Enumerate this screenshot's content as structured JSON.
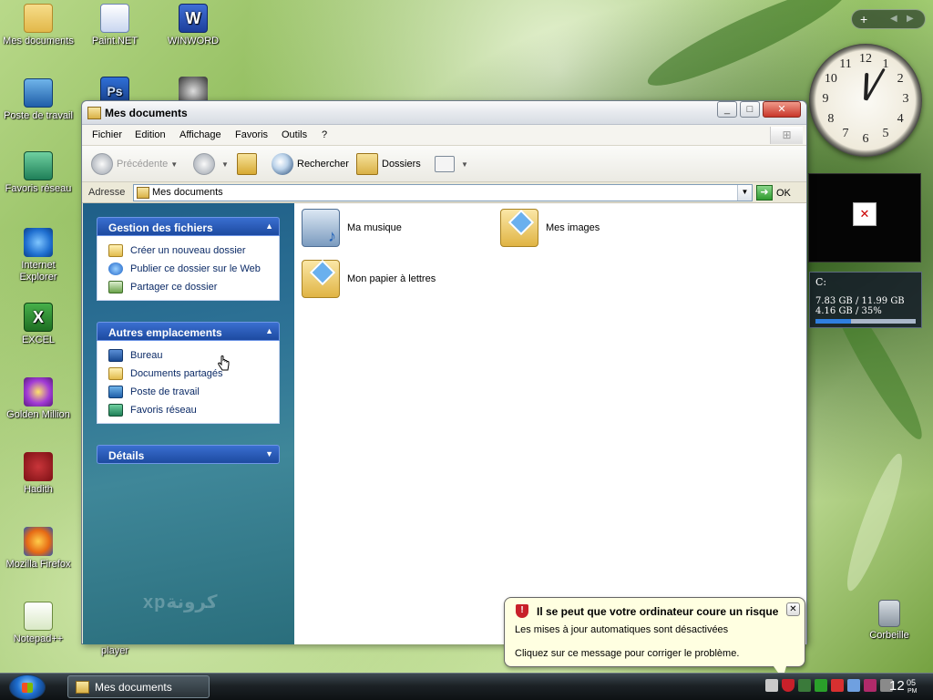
{
  "desktop": {
    "icons": [
      {
        "label": "Mes documents",
        "icon": "folder-icon"
      },
      {
        "label": "Paint.NET",
        "icon": "paint-icon"
      },
      {
        "label": "WINWORD",
        "icon": "word-icon"
      },
      {
        "label": "Poste de travail",
        "icon": "computer-icon"
      },
      {
        "label": "Favoris réseau",
        "icon": "network-icon"
      },
      {
        "label": "Internet Explorer",
        "icon": "ie-icon"
      },
      {
        "label": "EXCEL",
        "icon": "excel-icon"
      },
      {
        "label": "Golden Million",
        "icon": "golden-million-icon"
      },
      {
        "label": "Hadith",
        "icon": "hadith-icon"
      },
      {
        "label": "Mozilla Firefox",
        "icon": "firefox-icon"
      },
      {
        "label": "Notepad++",
        "icon": "notepad-icon"
      },
      {
        "label": "player",
        "icon": "player-icon"
      },
      {
        "label": "Corbeille",
        "icon": "recycle-bin-icon"
      }
    ],
    "ps_glyph": "Ps",
    "word_glyph": "W",
    "excel_glyph": "X"
  },
  "gadgets": {
    "clock": {
      "hour": 12,
      "minute": 5,
      "numbers": [
        "12",
        "1",
        "2",
        "3",
        "4",
        "5",
        "6",
        "7",
        "8",
        "9",
        "10",
        "11"
      ]
    },
    "toolbar_plus": "+",
    "toolbar_prev": "◀",
    "toolbar_next": "▶",
    "broken_image": "✕",
    "drive": {
      "title": "C:",
      "line1": "7.83 GB / 11.99 GB",
      "line2": "4.16 GB / 35%",
      "used_fraction": 0.35
    }
  },
  "window": {
    "title": "Mes documents",
    "controls": {
      "minimize": "_",
      "maximize": "□",
      "close": "✕"
    },
    "menu": [
      "Fichier",
      "Edition",
      "Affichage",
      "Favoris",
      "Outils",
      "?"
    ],
    "toolbar": {
      "back": "Précédente",
      "search": "Rechercher",
      "folders": "Dossiers"
    },
    "address": {
      "label": "Adresse",
      "value": "Mes documents",
      "go": "OK"
    },
    "tasks": {
      "title": "Gestion des fichiers",
      "items": [
        "Créer un nouveau dossier",
        "Publier ce dossier sur le Web",
        "Partager ce dossier"
      ]
    },
    "places": {
      "title": "Autres emplacements",
      "items": [
        "Bureau",
        "Documents partagés",
        "Poste de travail",
        "Favoris réseau"
      ]
    },
    "details": {
      "title": "Détails"
    },
    "brand_watermark": "xpكرونة",
    "folders": [
      "Ma musique",
      "Mes images",
      "Mon papier à lettres"
    ]
  },
  "balloon": {
    "title": "Il se peut que votre ordinateur coure un risque",
    "line1": "Les mises à jour automatiques sont désactivées",
    "line2": "Cliquez sur ce message pour corriger le problème.",
    "shield_glyph": "!",
    "close": "✕"
  },
  "taskbar": {
    "task": "Mes documents",
    "time": "12",
    "minutes": "05",
    "ampm": "PM"
  },
  "colors": {
    "panel_head": "#1d4aa0",
    "left_pane": "#2e7396",
    "balloon_bg": "#ffffe1",
    "close_red": "#c8362a"
  }
}
